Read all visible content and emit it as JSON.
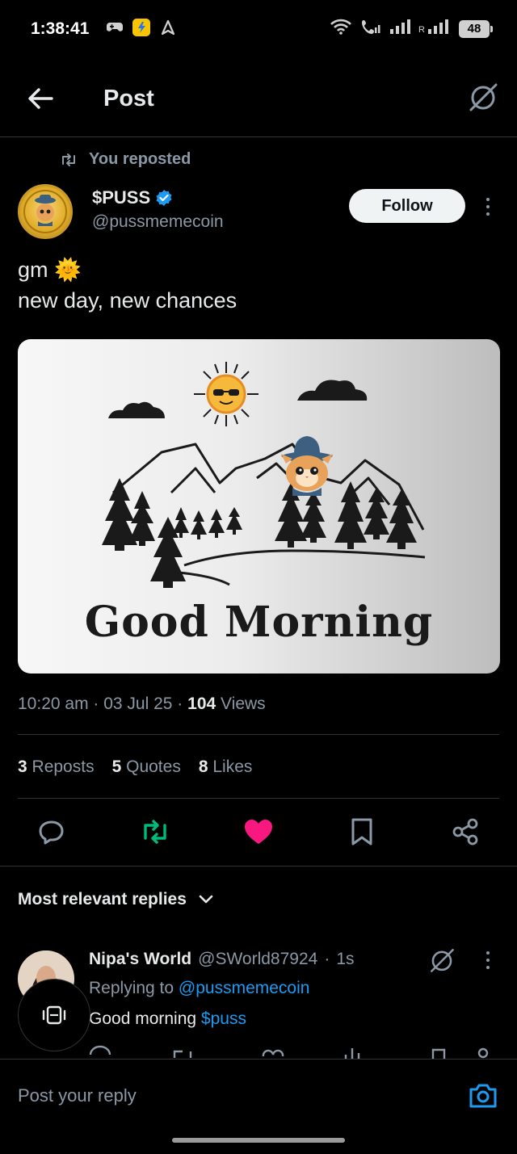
{
  "status_bar": {
    "time": "1:38:41",
    "battery": "48",
    "icons": [
      "game-controller-icon",
      "flipkart-icon",
      "location-arrow-icon",
      "wifi-icon",
      "volte-call-icon",
      "signal-icon",
      "roaming-signal-icon",
      "battery-icon"
    ]
  },
  "header": {
    "title": "Post",
    "back_icon": "arrow-left-icon",
    "grok_icon": "grok-icon"
  },
  "post": {
    "repost_label": "You reposted",
    "author": {
      "name": "$PUSS",
      "handle": "@pussmemecoin",
      "verified": true
    },
    "follow_label": "Follow",
    "text_line1": "gm",
    "text_emoji": "🌞",
    "text_line2": "new day, new chances",
    "image_caption": "Good Morning",
    "time": "10:20 am",
    "date": "03 Jul 25",
    "views_count": "104",
    "views_label": "Views",
    "reposts_count": "3",
    "reposts_label": "Reposts",
    "quotes_count": "5",
    "quotes_label": "Quotes",
    "likes_count": "8",
    "likes_label": "Likes"
  },
  "actions": [
    "reply-icon",
    "repost-icon",
    "like-icon",
    "bookmark-icon",
    "share-icon"
  ],
  "colors": {
    "repost_active": "#00ba7c",
    "like_active": "#f91880",
    "link": "#1d9bf0",
    "muted": "#8b98a5",
    "divider": "#2f3336"
  },
  "replies_section": {
    "title": "Most relevant replies"
  },
  "reply": {
    "name": "Nipa's World",
    "handle": "@SWorld87924",
    "age": "1s",
    "replying_prefix": "Replying to",
    "replying_to": "@pussmemecoin",
    "body_text": "Good morning",
    "body_tag": "$puss"
  },
  "composer": {
    "placeholder": "Post your reply"
  }
}
